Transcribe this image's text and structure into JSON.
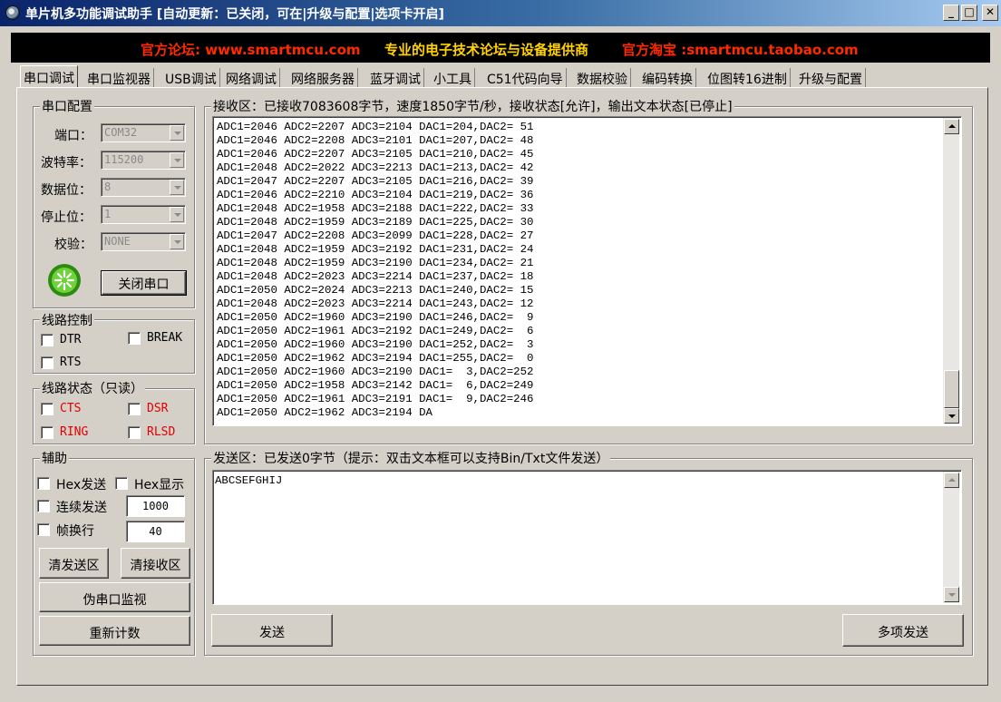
{
  "window": {
    "title": "单片机多功能调试助手 [自动更新：已关闭，可在|升级与配置|选项卡开启]",
    "minimize": "_",
    "maximize": "□",
    "close": "✕"
  },
  "banner": {
    "forum": "官方论坛: www.smartmcu.com",
    "slogan": "专业的电子技术论坛与设备提供商",
    "shop": "官方淘宝 :smartmcu.taobao.com",
    "colors": {
      "forum": "#ff2a00",
      "slogan": "#ffd200",
      "shop": "#ff2a00"
    }
  },
  "tabs": [
    "串口调试",
    "串口监视器",
    "USB调试",
    "网络调试",
    "网络服务器",
    "蓝牙调试",
    "小工具",
    "C51代码向导",
    "数据校验",
    "编码转换",
    "位图转16进制",
    "升级与配置"
  ],
  "serial_config": {
    "title": "串口配置",
    "port": {
      "label": "端口：",
      "value": "COM32"
    },
    "baud": {
      "label": "波特率：",
      "value": "115200"
    },
    "databits": {
      "label": "数据位：",
      "value": "8"
    },
    "stopbits": {
      "label": "停止位：",
      "value": "1"
    },
    "parity": {
      "label": "校验：",
      "value": "NONE"
    },
    "close_button": "关闭串口",
    "status_icon": "green-status-light"
  },
  "line_control": {
    "title": "线路控制",
    "dtr": "DTR",
    "break": "BREAK",
    "rts": "RTS"
  },
  "line_status": {
    "title": "线路状态（只读）",
    "cts": "CTS",
    "dsr": "DSR",
    "ring": "RING",
    "rlsd": "RLSD",
    "color": "#e00000"
  },
  "aux": {
    "title": "辅助",
    "hex_send": "Hex发送",
    "hex_show": "Hex显示",
    "continuous": "连续发送",
    "continuous_value": "1000",
    "frame_newline": "帧换行",
    "frame_value": "40",
    "clear_send": "清发送区",
    "clear_recv": "清接收区",
    "pseudo_monitor": "伪串口监视",
    "recount": "重新计数"
  },
  "receive": {
    "title": "接收区：已接收7083608字节，速度1850字节/秒，接收状态[允许]，输出文本状态[已停止]",
    "lines": [
      "ADC1=2046 ADC2=2207 ADC3=2104 DAC1=204,DAC2= 51",
      "ADC1=2046 ADC2=2208 ADC3=2101 DAC1=207,DAC2= 48",
      "ADC1=2046 ADC2=2207 ADC3=2105 DAC1=210,DAC2= 45",
      "ADC1=2048 ADC2=2022 ADC3=2213 DAC1=213,DAC2= 42",
      "ADC1=2047 ADC2=2207 ADC3=2105 DAC1=216,DAC2= 39",
      "ADC1=2046 ADC2=2210 ADC3=2104 DAC1=219,DAC2= 36",
      "ADC1=2048 ADC2=1958 ADC3=2188 DAC1=222,DAC2= 33",
      "ADC1=2048 ADC2=1959 ADC3=2189 DAC1=225,DAC2= 30",
      "ADC1=2047 ADC2=2208 ADC3=2099 DAC1=228,DAC2= 27",
      "ADC1=2048 ADC2=1959 ADC3=2192 DAC1=231,DAC2= 24",
      "ADC1=2048 ADC2=1959 ADC3=2190 DAC1=234,DAC2= 21",
      "ADC1=2048 ADC2=2023 ADC3=2214 DAC1=237,DAC2= 18",
      "ADC1=2050 ADC2=2024 ADC3=2213 DAC1=240,DAC2= 15",
      "ADC1=2048 ADC2=2023 ADC3=2214 DAC1=243,DAC2= 12",
      "ADC1=2050 ADC2=1960 ADC3=2190 DAC1=246,DAC2=  9",
      "ADC1=2050 ADC2=1961 ADC3=2192 DAC1=249,DAC2=  6",
      "ADC1=2050 ADC2=1960 ADC3=2190 DAC1=252,DAC2=  3",
      "ADC1=2050 ADC2=1962 ADC3=2194 DAC1=255,DAC2=  0",
      "ADC1=2050 ADC2=1960 ADC3=2190 DAC1=  3,DAC2=252",
      "ADC1=2050 ADC2=1958 ADC3=2142 DAC1=  6,DAC2=249",
      "ADC1=2050 ADC2=1961 ADC3=2191 DAC1=  9,DAC2=246",
      "ADC1=2050 ADC2=1962 ADC3=2194 DA"
    ]
  },
  "send": {
    "title": "发送区：已发送0字节（提示：双击文本框可以支持Bin/Txt文件发送）",
    "text": "ABCSEFGHIJ",
    "send_button": "发送",
    "multi_send_button": "多项发送"
  }
}
